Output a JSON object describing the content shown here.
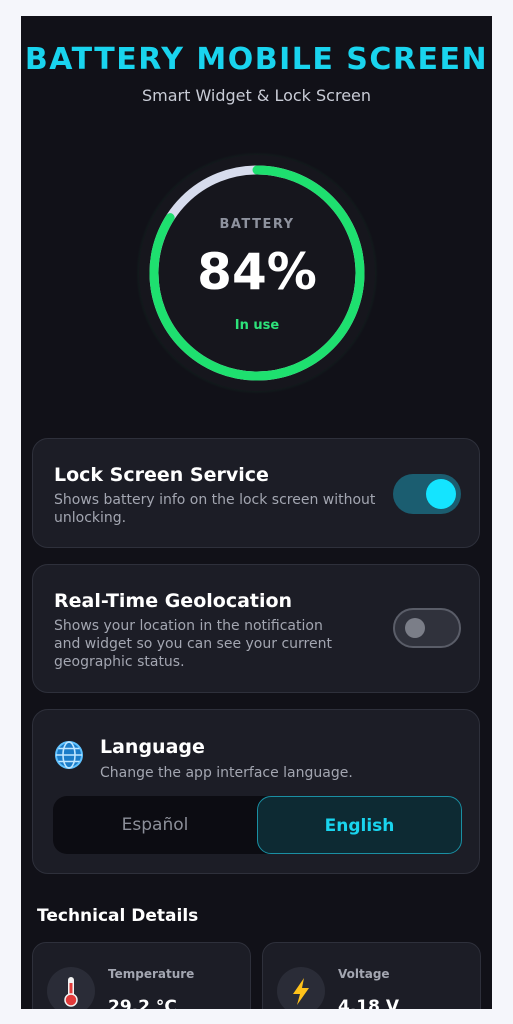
{
  "header": {
    "title": "BATTERY MOBILE SCREEN",
    "subtitle": "Smart Widget & Lock Screen"
  },
  "battery": {
    "label": "BATTERY",
    "percent_text": "84%",
    "level": 0.84,
    "status": "In use",
    "accent_color": "#1ee06f"
  },
  "lock_screen": {
    "title": "Lock Screen Service",
    "description_line1": "Shows battery info on the lock screen without",
    "description_line2": "unlocking.",
    "enabled": true
  },
  "geolocation": {
    "title": "Real-Time Geolocation",
    "description_line1": "Shows your location in the notification",
    "description_line2": "and widget so you can see your current",
    "description_line3": "geographic status.",
    "enabled": false
  },
  "language": {
    "icon": "globe-icon",
    "title": "Language",
    "description": "Change the app interface language.",
    "options": [
      "Español",
      "English"
    ],
    "selected": "English"
  },
  "technical_details": {
    "title": "Technical Details",
    "tiles": [
      {
        "icon": "thermometer-icon",
        "label": "Temperature",
        "value": "29.2 °C"
      },
      {
        "icon": "lightning-icon",
        "label": "Voltage",
        "value": "4.18 V"
      }
    ]
  },
  "colors": {
    "accent": "#19d4ee",
    "background": "#111118",
    "card": "#1c1d26",
    "success": "#1ee06f"
  }
}
